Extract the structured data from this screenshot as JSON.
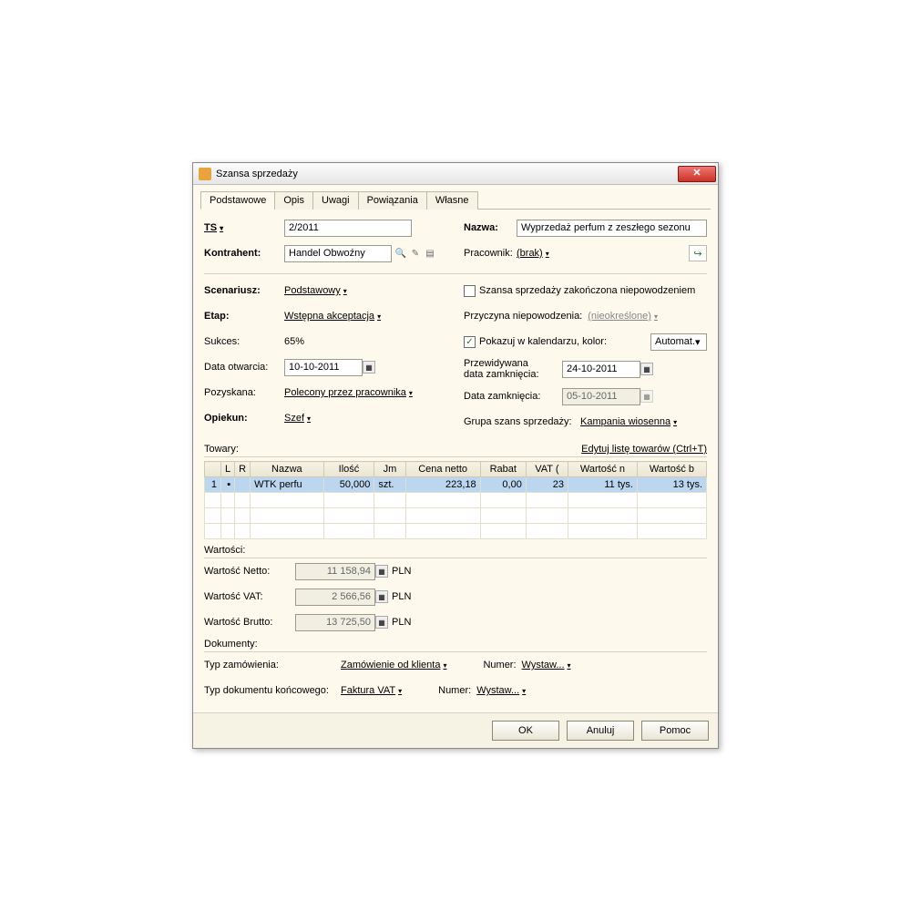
{
  "window": {
    "title": "Szansa sprzedaży"
  },
  "tabs": [
    "Podstawowe",
    "Opis",
    "Uwagi",
    "Powiązania",
    "Własne"
  ],
  "header": {
    "ts_label": "TS",
    "ts_value": "2/2011",
    "name_label": "Nazwa:",
    "name_value": "Wyprzedaż perfum z zeszłego sezonu",
    "contractor_label": "Kontrahent:",
    "contractor_value": "Handel Obwoźny",
    "employee_label": "Pracownik:",
    "employee_value": "(brak)"
  },
  "left": {
    "scenario_label": "Scenariusz:",
    "scenario_value": "Podstawowy",
    "stage_label": "Etap:",
    "stage_value": "Wstępna akceptacja",
    "success_label": "Sukces:",
    "success_value": "65%",
    "open_label": "Data otwarcia:",
    "open_value": "10-10-2011",
    "acquired_label": "Pozyskana:",
    "acquired_value": "Polecony przez pracownika",
    "owner_label": "Opiekun:",
    "owner_value": "Szef"
  },
  "right": {
    "failed_label": "Szansa sprzedaży zakończona niepowodzeniem",
    "fail_reason_label": "Przyczyna niepowodzenia:",
    "fail_reason_value": "(nieokreślone)",
    "show_cal_label": "Pokazuj w kalendarzu, kolor:",
    "color_value": "Automat.",
    "expected_label": "Przewidywana\ndata zamknięcia:",
    "expected_value": "24-10-2011",
    "close_label": "Data zamknięcia:",
    "close_value": "05-10-2011",
    "group_label": "Grupa szans sprzedaży:",
    "group_value": "Kampania wiosenna"
  },
  "goods": {
    "label": "Towary:",
    "edit_link": "Edytuj listę towarów   (Ctrl+T)",
    "cols": [
      "",
      "L",
      "R",
      "Nazwa",
      "Ilość",
      "Jm",
      "Cena netto",
      "Rabat",
      "VAT (",
      "Wartość n",
      "Wartość b"
    ],
    "row": {
      "n": "1",
      "nazwa": "WTK perfu",
      "ilosc": "50,000",
      "jm": "szt.",
      "cena": "223,18",
      "rabat": "0,00",
      "vat": "23",
      "wn": "11 tys.",
      "wb": "13 tys."
    }
  },
  "values": {
    "label": "Wartości:",
    "netto_label": "Wartość Netto:",
    "netto_value": "11 158,94",
    "vat_label": "Wartość VAT:",
    "vat_value": "2 566,56",
    "brutto_label": "Wartość Brutto:",
    "brutto_value": "13 725,50",
    "currency": "PLN"
  },
  "docs": {
    "label": "Dokumenty:",
    "order_type_label": "Typ zamówienia:",
    "order_type_value": "Zamówienie od klienta",
    "final_doc_label": "Typ dokumentu końcowego:",
    "final_doc_value": "Faktura VAT",
    "numer_label": "Numer:",
    "numer_value": "Wystaw..."
  },
  "footer": {
    "ok": "OK",
    "cancel": "Anuluj",
    "help": "Pomoc"
  }
}
